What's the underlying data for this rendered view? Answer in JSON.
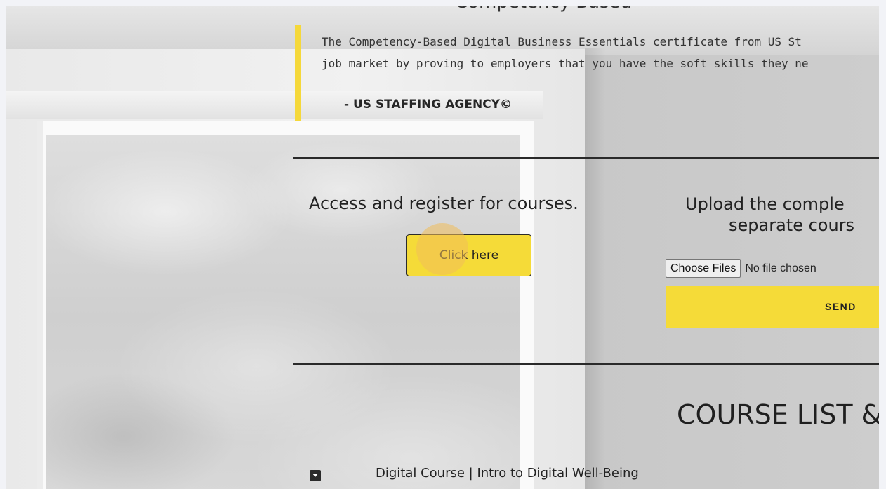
{
  "hero": {
    "heading": "Competency-Based"
  },
  "quote": {
    "line1": "The Competency-Based Digital Business Essentials certificate from US St",
    "line2": "job market by proving to employers that you have the soft skills they ne",
    "author": "- US STAFFING AGENCY©",
    "accent_color": "#f5d83a"
  },
  "register": {
    "title": "Access and register for courses.",
    "button_label": "Click here",
    "button_color": "#f5db38"
  },
  "upload": {
    "title_line1": "Upload the comple",
    "title_line2": "separate cours",
    "choose_label": "Choose Files",
    "file_status": "No file chosen",
    "send_label": "SEND"
  },
  "courses": {
    "title": "COURSE LIST &",
    "items": [
      {
        "label": "Digital Course | Intro to Digital Well-Being",
        "icon": "chevron-down-icon"
      }
    ]
  }
}
